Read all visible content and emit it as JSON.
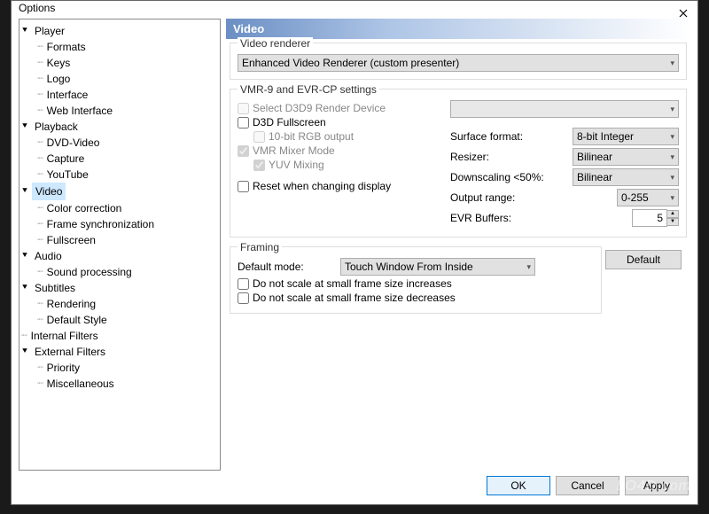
{
  "window": {
    "title": "Options"
  },
  "tree": {
    "player": "Player",
    "formats": "Formats",
    "keys": "Keys",
    "logo": "Logo",
    "interface": "Interface",
    "web_interface": "Web Interface",
    "playback": "Playback",
    "dvd_video": "DVD-Video",
    "capture": "Capture",
    "youtube": "YouTube",
    "video": "Video",
    "color_correction": "Color correction",
    "frame_sync": "Frame synchronization",
    "fullscreen": "Fullscreen",
    "audio": "Audio",
    "sound_processing": "Sound processing",
    "subtitles": "Subtitles",
    "rendering": "Rendering",
    "default_style": "Default Style",
    "internal_filters": "Internal Filters",
    "external_filters": "External Filters",
    "priority": "Priority",
    "miscellaneous": "Miscellaneous"
  },
  "panel": {
    "title": "Video",
    "renderer": {
      "legend": "Video renderer",
      "value": "Enhanced Video Renderer (custom presenter)"
    },
    "vmr": {
      "legend": "VMR-9 and EVR-CP settings",
      "select_d3d9": "Select D3D9 Render Device",
      "d3d_fullscreen": "D3D Fullscreen",
      "tenbit": "10-bit RGB output",
      "vmr_mixer": "VMR Mixer Mode",
      "yuv_mixing": "YUV Mixing",
      "reset_display": "Reset when changing display",
      "surface_format_label": "Surface format:",
      "surface_format_value": "8-bit Integer",
      "resizer_label": "Resizer:",
      "resizer_value": "Bilinear",
      "downscaling_label": "Downscaling <50%:",
      "downscaling_value": "Bilinear",
      "output_range_label": "Output range:",
      "output_range_value": "0-255",
      "evr_buffers_label": "EVR Buffers:",
      "evr_buffers_value": "5"
    },
    "framing": {
      "legend": "Framing",
      "default_mode_label": "Default mode:",
      "default_mode_value": "Touch Window From Inside",
      "no_scale_inc": "Do not scale at small frame size increases",
      "no_scale_dec": "Do not scale at small frame size decreases"
    },
    "default_btn": "Default"
  },
  "buttons": {
    "ok": "OK",
    "cancel": "Cancel",
    "apply": "Apply"
  },
  "watermark": "LO4D.com"
}
